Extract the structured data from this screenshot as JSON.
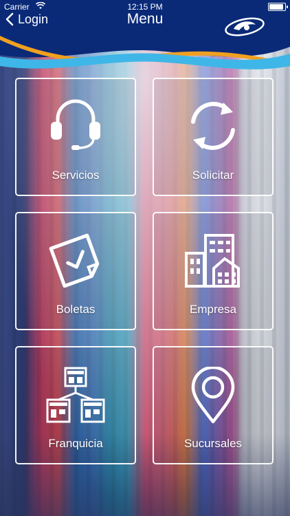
{
  "status_bar": {
    "carrier": "Carrier",
    "time": "12:15 PM"
  },
  "nav": {
    "back_label": "Login",
    "title": "Menu"
  },
  "colors": {
    "header_blue": "#0a2a78",
    "accent_orange": "#f0a020",
    "accent_cyan": "#3fb6e8",
    "tile_border": "#ffffff"
  },
  "menu": {
    "items": [
      {
        "label": "Servicios",
        "icon": "headset-icon"
      },
      {
        "label": "Solicitar",
        "icon": "refresh-icon"
      },
      {
        "label": "Boletas",
        "icon": "receipt-check-icon"
      },
      {
        "label": "Empresa",
        "icon": "buildings-icon"
      },
      {
        "label": "Franquicia",
        "icon": "store-network-icon"
      },
      {
        "label": "Sucursales",
        "icon": "location-pin-icon"
      }
    ]
  }
}
